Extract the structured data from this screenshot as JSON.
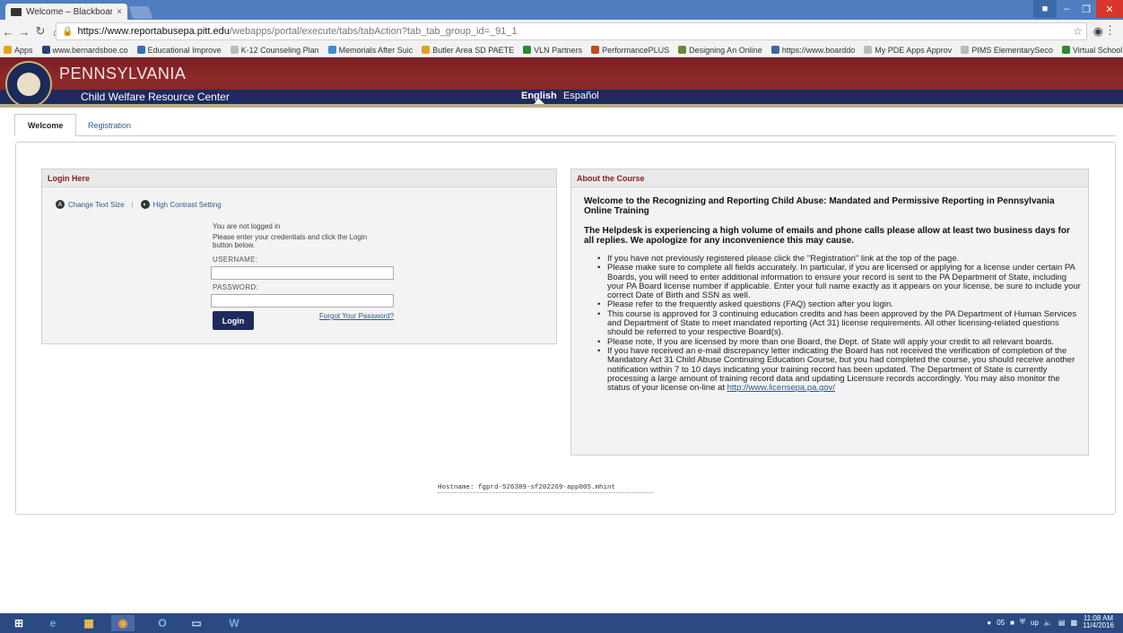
{
  "browser": {
    "tab_title": "Welcome – Blackboard L",
    "tab_close": "×",
    "url_host": "https://www.reportabusepa.pitt.edu",
    "url_path": "/webapps/portal/execute/tabs/tabAction?tab_tab_group_id=_91_1",
    "bookmarks": [
      {
        "label": "Apps",
        "color": "#e5a31d"
      },
      {
        "label": "www.bernardsboe.co",
        "color": "#2a3f7a"
      },
      {
        "label": "Educational Improve",
        "color": "#3a6fb5"
      },
      {
        "label": "K-12 Counseling Plan",
        "color": "#bbbbbb"
      },
      {
        "label": "Memorials After Suic",
        "color": "#3b8ad9"
      },
      {
        "label": "Butler Area SD PAETE",
        "color": "#e0a020"
      },
      {
        "label": "VLN Partners",
        "color": "#2e8b2e"
      },
      {
        "label": "PerformancePLUS",
        "color": "#c74a1a"
      },
      {
        "label": "Designing An Online",
        "color": "#6a8a3a"
      },
      {
        "label": "https://www.boarddo",
        "color": "#3a6a9a"
      },
      {
        "label": "My PDE Apps Approv",
        "color": "#bbbbbb"
      },
      {
        "label": "PIMS ElementarySeco",
        "color": "#bbbbbb"
      },
      {
        "label": "Virtual School Toolkit",
        "color": "#2e8b2e"
      }
    ]
  },
  "site": {
    "brand_line1": "PENNSYLVANIA",
    "brand_line2": "Child Welfare Resource Center",
    "lang_en": "English",
    "lang_es": "Español",
    "tabs": [
      {
        "label": "Welcome"
      },
      {
        "label": "Registration"
      }
    ]
  },
  "login": {
    "header": "Login Here",
    "change_text_size": "Change Text Size",
    "high_contrast": "High Contrast Setting",
    "not_logged_in": "You are not logged in",
    "instruction_1": "Please enter your credentials and click the Login",
    "instruction_2": "button below.",
    "username_label": "USERNAME:",
    "username_value": "",
    "password_label": "PASSWORD:",
    "password_value": "",
    "login_button": "Login",
    "forgot_link": "Forgot Your Password?"
  },
  "about": {
    "header": "About the Course",
    "welcome": "Welcome to the Recognizing and Reporting Child Abuse: Mandated and Permissive Reporting in Pennsylvania Online Training",
    "helpdesk": "The Helpdesk is experiencing a high volume of emails and phone calls please allow at least two business days for all replies. We apologize for any inconvenience this may cause.",
    "bullets": [
      "If you have not previously registered please click the \"Registration\" link at the top of the page.",
      "Please make sure to complete all fields accurately. In particular, if you are licensed or applying for a license under certain PA Boards, you will need to enter additional information to ensure your record is sent to the PA Department of State, including your PA Board license number if applicable. Enter your full name exactly as it appears on your license, be sure to include your correct Date of Birth and SSN as well.",
      "Please refer to the frequently asked questions (FAQ) section after you login.",
      "This course is approved for 3 continuing education credits and has been approved by the PA Department of Human Services and Department of State to meet mandated reporting (Act 31) license requirements. All other licensing-related questions should be referred to your respective Board(s).",
      "Please note, If you are licensed by more than one Board, the Dept. of State will apply your credit to all relevant boards."
    ],
    "last_bullet": "If you have received an e-mail discrepancy letter indicating the Board has not received the verification of completion of the Mandatory Act 31 Child Abuse Continuing Education Course, but you had completed the course, you should receive another notification within 7 to 10 days indicating your training record has been updated. The Department of State is currently processing a large amount of training record data and updating Licensure records accordingly. You may also monitor the status of your license on-line at",
    "link": "http://www.licensepa.pa.gov/"
  },
  "footer": {
    "hostname": "Hostname: fgprd-526389-sf202269-app005.mhint"
  },
  "taskbar": {
    "tray_text": "05",
    "tray_up": "up",
    "time": "11:08 AM",
    "date": "11/4/2016"
  }
}
